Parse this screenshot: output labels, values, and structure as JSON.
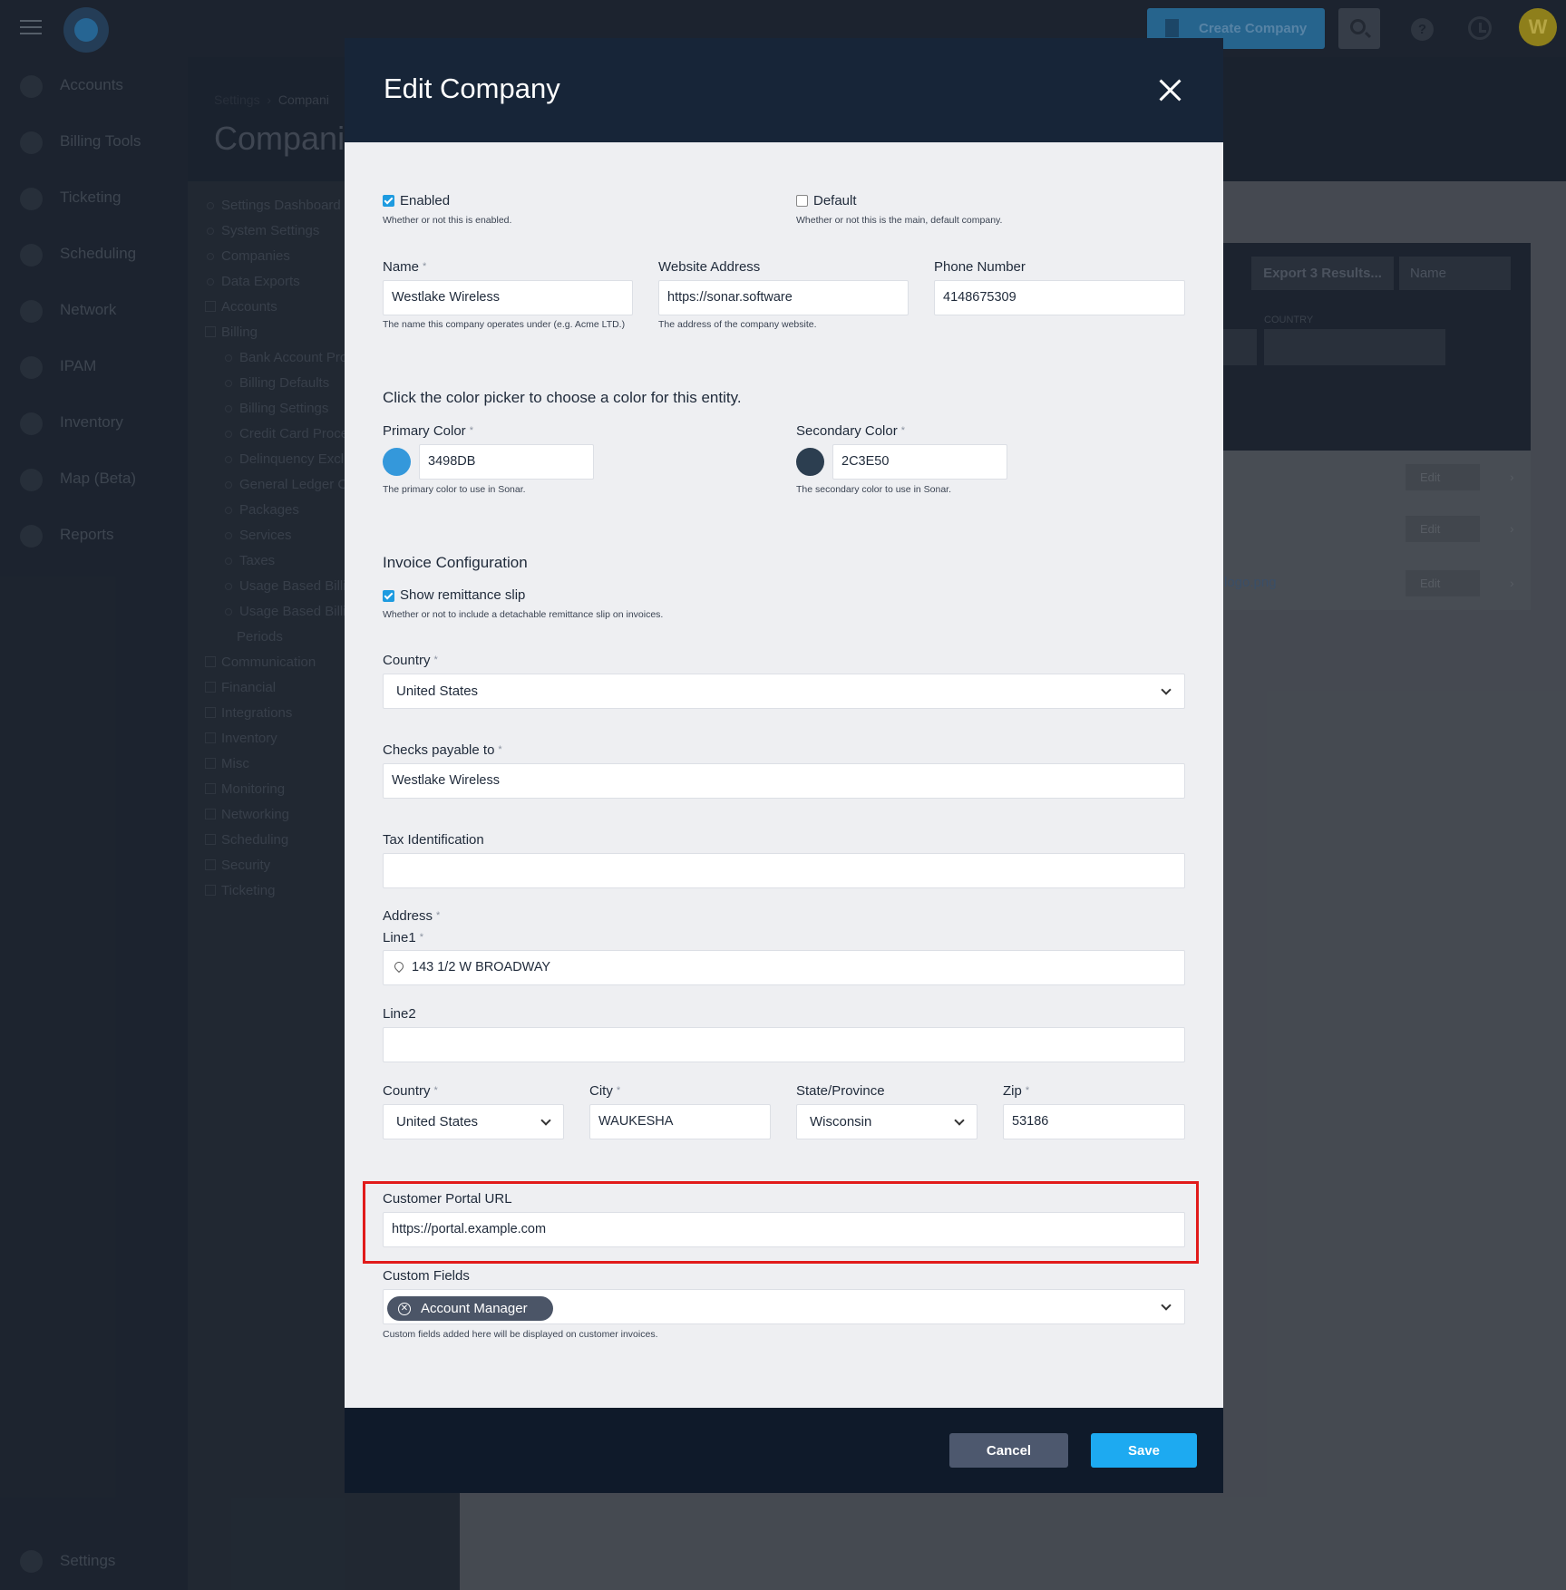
{
  "topbar": {
    "create_label": "Create Company",
    "avatar_initial": "W"
  },
  "sidebar": {
    "items": [
      {
        "label": "Accounts",
        "icon": "accounts-icon"
      },
      {
        "label": "Billing Tools",
        "icon": "calculator-icon"
      },
      {
        "label": "Ticketing",
        "icon": "chat-icon"
      },
      {
        "label": "Scheduling",
        "icon": "calendar-icon"
      },
      {
        "label": "Network",
        "icon": "network-icon"
      },
      {
        "label": "IPAM",
        "icon": "ipam-icon"
      },
      {
        "label": "Inventory",
        "icon": "cart-icon"
      },
      {
        "label": "Map (Beta)",
        "icon": "map-icon"
      },
      {
        "label": "Reports",
        "icon": "report-icon"
      }
    ],
    "settings_label": "Settings"
  },
  "page": {
    "crumb_root": "Settings",
    "crumb_sep": "›",
    "crumb_current": "Compani",
    "title": "Compani"
  },
  "subnav": {
    "items": [
      {
        "label": "Settings Dashboard"
      },
      {
        "label": "System Settings"
      },
      {
        "label": "Companies"
      },
      {
        "label": "Data Exports"
      },
      {
        "label": "Accounts"
      },
      {
        "label": "Billing"
      },
      {
        "label": "Bank Account Pro"
      },
      {
        "label": "Billing Defaults"
      },
      {
        "label": "Billing Settings"
      },
      {
        "label": "Credit Card Proce"
      },
      {
        "label": "Delinquency Excl"
      },
      {
        "label": "General Ledger C"
      },
      {
        "label": "Packages"
      },
      {
        "label": "Services"
      },
      {
        "label": "Taxes"
      },
      {
        "label": "Usage Based Billi"
      },
      {
        "label": "Usage Based Billi"
      },
      {
        "label": "Periods"
      },
      {
        "label": "Communication"
      },
      {
        "label": "Financial"
      },
      {
        "label": "Integrations"
      },
      {
        "label": "Inventory"
      },
      {
        "label": "Misc"
      },
      {
        "label": "Monitoring"
      },
      {
        "label": "Networking"
      },
      {
        "label": "Scheduling"
      },
      {
        "label": "Security"
      },
      {
        "label": "Ticketing"
      }
    ]
  },
  "background_panel": {
    "export_label": "Export 3 Results...",
    "sort_label": "Name",
    "country_label": "COUNTRY",
    "row_edit": "Edit",
    "row_link": "r-logo.png"
  },
  "modal": {
    "title": "Edit Company",
    "enabled": {
      "label": "Enabled",
      "hint": "Whether or not this is enabled.",
      "checked": true
    },
    "default": {
      "label": "Default",
      "hint": "Whether or not this is the main, default company.",
      "checked": false
    },
    "name": {
      "label": "Name",
      "value": "Westlake Wireless",
      "hint": "The name this company operates under (e.g. Acme LTD.)"
    },
    "website": {
      "label": "Website Address",
      "value": "https://sonar.software",
      "hint": "The address of the company website."
    },
    "phone": {
      "label": "Phone Number",
      "value": "4148675309"
    },
    "color_intro": "Click the color picker to choose a color for this entity.",
    "primary_color": {
      "label": "Primary Color",
      "value": "3498DB",
      "swatch": "#3498DB",
      "hint": "The primary color to use in Sonar."
    },
    "secondary_color": {
      "label": "Secondary Color",
      "value": "2C3E50",
      "swatch": "#2C3E50",
      "hint": "The secondary color to use in Sonar."
    },
    "invoice_heading": "Invoice Configuration",
    "remittance": {
      "label": "Show remittance slip",
      "hint": "Whether or not to include a detachable remittance slip on invoices.",
      "checked": true
    },
    "country": {
      "label": "Country",
      "value": "United States"
    },
    "checks_payable": {
      "label": "Checks payable to",
      "value": "Westlake Wireless"
    },
    "tax_id": {
      "label": "Tax Identification",
      "value": ""
    },
    "address": {
      "label": "Address",
      "line1_label": "Line1",
      "line1_value": "143 1/2 W BROADWAY",
      "line2_label": "Line2",
      "line2_value": "",
      "country_label": "Country",
      "country_value": "United States",
      "city_label": "City",
      "city_value": "WAUKESHA",
      "state_label": "State/Province",
      "state_value": "Wisconsin",
      "zip_label": "Zip",
      "zip_value": "53186"
    },
    "portal_url": {
      "label": "Customer Portal URL",
      "value": "https://portal.example.com"
    },
    "custom_fields": {
      "label": "Custom Fields",
      "chip": "Account Manager",
      "hint": "Custom fields added here will be displayed on customer invoices."
    },
    "required_mark": "*",
    "cancel_label": "Cancel",
    "save_label": "Save"
  }
}
